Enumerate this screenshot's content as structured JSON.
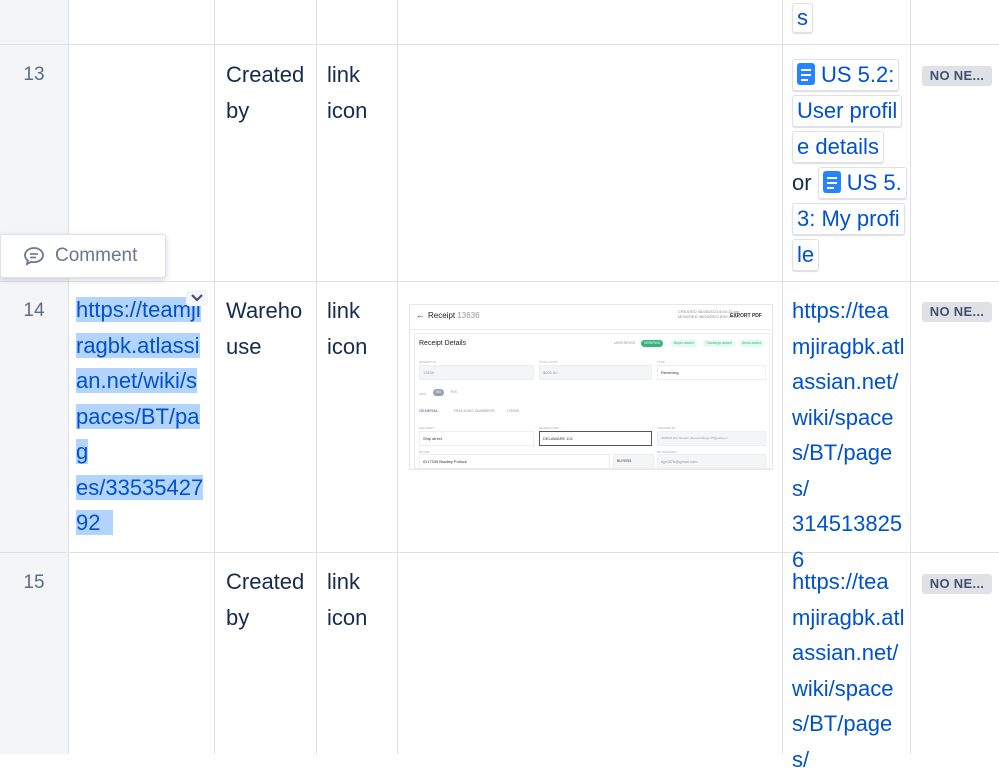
{
  "rows": [
    {
      "num": "13",
      "type": "Created by",
      "field": "link icon",
      "status": "NO NE..."
    },
    {
      "num": "14",
      "type": "Wareho use",
      "field": "link icon",
      "status": "NO NE..."
    },
    {
      "num": "15",
      "type": "Created by",
      "field": "link icon",
      "status": "NO NE..."
    }
  ],
  "top_fragment": "s",
  "row13_links": {
    "chip1_line1": "US 5.2:",
    "chip1_line2": "User profil",
    "chip1_line3": "e details",
    "or": "or",
    "chip2_line1": "US 5.",
    "chip2_line2": "3: My profi",
    "chip2_line3": "le"
  },
  "row14_selected_url": [
    "https://teamji",
    "ragbk.atlassi",
    "an.net/wiki/s",
    "paces/BT/pag",
    "es/33535427",
    "92"
  ],
  "row14_link": [
    "https://tea",
    "mjiragbk.atl",
    "assian.net/",
    "wiki/space",
    "s/BT/pages/",
    "314513825",
    "6"
  ],
  "row15_link": [
    "https://tea",
    "mjiragbk.atl",
    "assian.net/",
    "wiki/space",
    "s/BT/pages/"
  ],
  "comment": {
    "label": "Comment",
    "icon": "comment-icon"
  },
  "receipt": {
    "back": "←",
    "title": "Receipt",
    "number": "13636",
    "created": "CREATED",
    "modified": "MODIFIED",
    "created_date": "06/25/2023 8:50:10 am",
    "modified_date": "06/25/2023 8:50:10 am",
    "export": "EXPORT PDF",
    "heading": "Receipt Details",
    "badge_unverified": "UNVERIFIED",
    "badge_verified": "VERIFIED",
    "badge_buyer": "Buyer added",
    "badge_tracking": "Trackings added",
    "badge_items": "Items added",
    "receipt_id_label": "RECEIPT ID",
    "receipt_id": "13636",
    "total_cost_label": "TOTAL COST",
    "total_cost": "$500.00",
    "type_label": "TYPE",
    "type": "Receiving",
    "ship_label": "SHIP",
    "no": "NO",
    "yes": "YES",
    "tab_general": "GENERAL",
    "tab_tracking": "TRACKING NUMBERS",
    "tab_items": "ITEMS",
    "delivery_label": "DELIVERY *",
    "delivery": "Ship direct",
    "warehouse_label": "WAREHOUSE *",
    "warehouse": "DELAWARE 101",
    "created_by_label": "CREATED BY",
    "created_by": "ID20934 Eric Strastic (laurenbullinger75@yahoo.c",
    "buyer_label": "BUYER",
    "buyer": "ID17335 Bradley Pollock",
    "buyers_btn": "BUYERS",
    "buyer_email_label": "BUYER EMAIL",
    "buyer_email": "bjp0878@gmail.com"
  },
  "colors": {
    "link": "#0052cc",
    "selection": "#b3d4ff",
    "chip_icon": "#2684ff",
    "verified": "#36b37e"
  }
}
